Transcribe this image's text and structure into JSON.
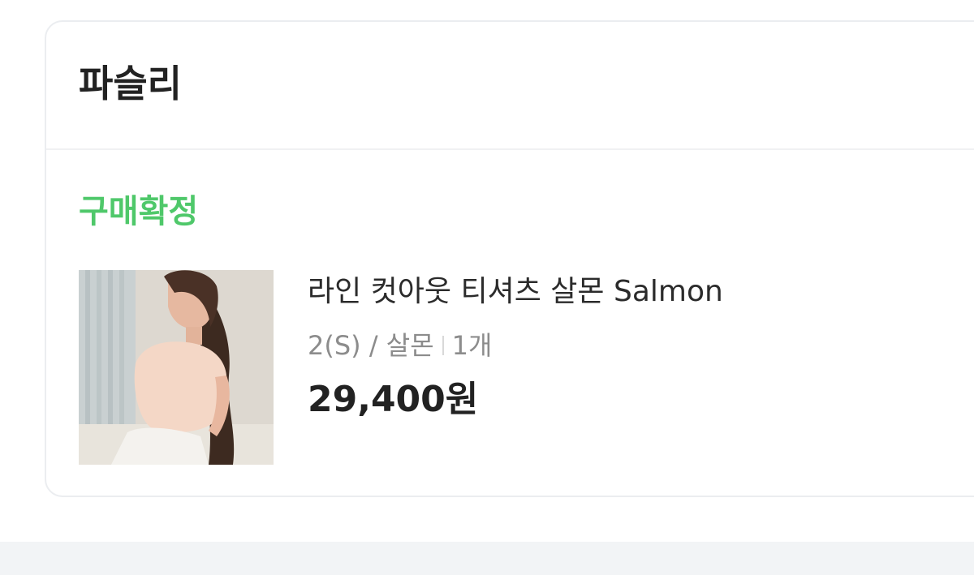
{
  "seller": {
    "name": "파슬리"
  },
  "order": {
    "status": "구매확정",
    "status_color": "#4fc86a"
  },
  "product": {
    "image_alt": "salmon line cutout t-shirt product photo",
    "name": "라인 컷아웃 티셔츠 살몬 Salmon",
    "option": "2(S) / 살몬",
    "quantity": "1개",
    "price": "29,400원"
  }
}
